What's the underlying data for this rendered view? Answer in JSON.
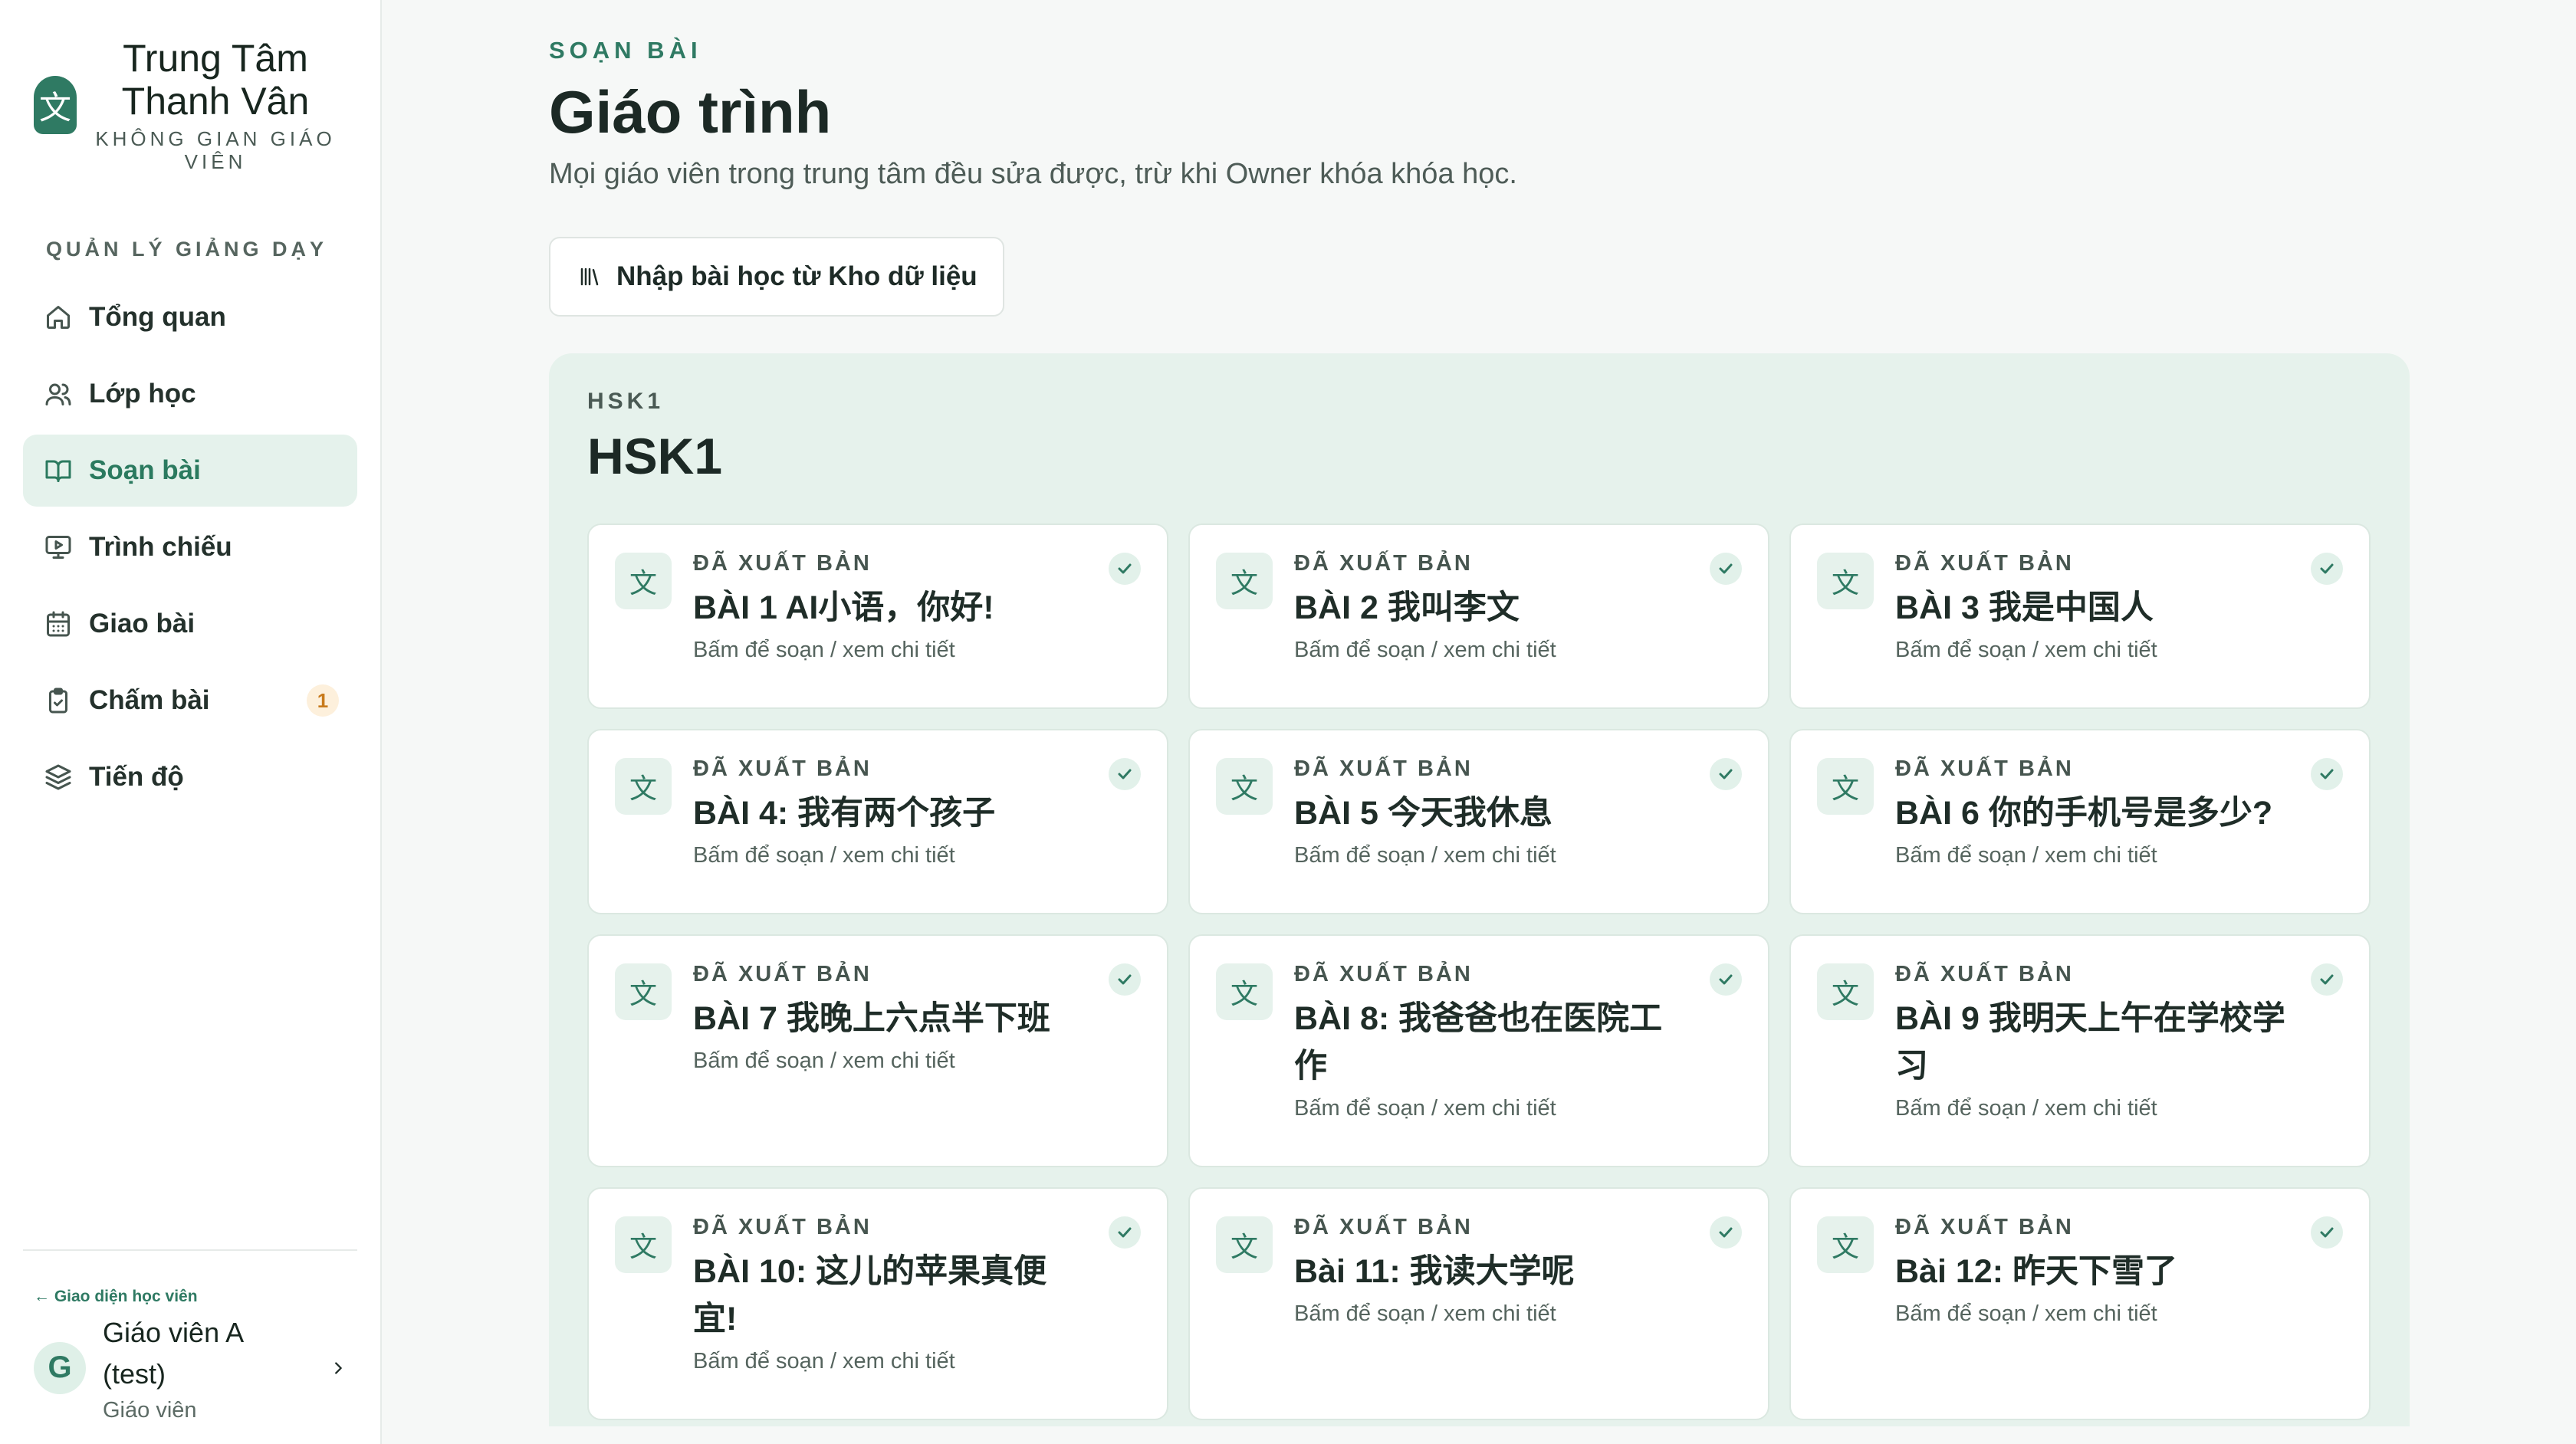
{
  "brand": {
    "icon_char": "文",
    "name_line1": "Trung Tâm",
    "name_line2": "Thanh Vân",
    "subtitle_line1": "KHÔNG GIAN GIÁO",
    "subtitle_line2": "VIÊN"
  },
  "sidebar": {
    "section_title": "QUẢN LÝ GIẢNG DẠY",
    "items": [
      {
        "label": "Tổng quan",
        "icon": "home-icon"
      },
      {
        "label": "Lớp học",
        "icon": "users-icon"
      },
      {
        "label": "Soạn bài",
        "icon": "book-open-icon",
        "active": true
      },
      {
        "label": "Trình chiếu",
        "icon": "presentation-icon"
      },
      {
        "label": "Giao bài",
        "icon": "calendar-icon"
      },
      {
        "label": "Chấm bài",
        "icon": "clipboard-check-icon",
        "badge": "1"
      },
      {
        "label": "Tiến độ",
        "icon": "layers-icon"
      }
    ]
  },
  "footer": {
    "student_link": "← Giao diện học viên",
    "avatar_initial": "G",
    "user_name_line1": "Giáo viên A",
    "user_name_line2": "(test)",
    "user_role": "Giáo viên"
  },
  "main": {
    "eyebrow": "SOẠN BÀI",
    "title": "Giáo trình",
    "description": "Mọi giáo viên trong trung tâm đều sửa được, trừ khi Owner khóa khóa học.",
    "import_button": "Nhập bài học từ Kho dữ liệu"
  },
  "course": {
    "tag": "HSK1",
    "title": "HSK1",
    "card_icon_char": "文",
    "lessons": [
      {
        "status": "ĐÃ XUẤT BẢN",
        "title_line1": "BÀI 1 AI小语，你好!",
        "title_line2": "",
        "hint": "Bấm để soạn / xem chi tiết"
      },
      {
        "status": "ĐÃ XUẤT BẢN",
        "title_line1": "BÀI 2 我叫李文",
        "title_line2": "",
        "hint": "Bấm để soạn / xem chi tiết"
      },
      {
        "status": "ĐÃ XUẤT BẢN",
        "title_line1": "BÀI 3 我是中国人",
        "title_line2": "",
        "hint": "Bấm để soạn / xem chi tiết"
      },
      {
        "status": "ĐÃ XUẤT BẢN",
        "title_line1": "BÀI 4: 我有两个孩子",
        "title_line2": "",
        "hint": "Bấm để soạn / xem chi tiết"
      },
      {
        "status": "ĐÃ XUẤT BẢN",
        "title_line1": "BÀI 5 今天我休息",
        "title_line2": "",
        "hint": "Bấm để soạn / xem chi tiết"
      },
      {
        "status": "ĐÃ XUẤT BẢN",
        "title_line1": "BÀI 6 你的手机号是多少?",
        "title_line2": "",
        "hint": "Bấm để soạn / xem chi tiết"
      },
      {
        "status": "ĐÃ XUẤT BẢN",
        "title_line1": "BÀI 7 我晚上六点半下班",
        "title_line2": "",
        "hint": "Bấm để soạn / xem chi tiết"
      },
      {
        "status": "ĐÃ XUẤT BẢN",
        "title_line1": "BÀI 8: 我爸爸也在医院工作",
        "title_line2": "",
        "hint": "Bấm để soạn / xem chi tiết"
      },
      {
        "status": "ĐÃ XUẤT BẢN",
        "title_line1": "BÀI 9 我明天上午在学校学",
        "title_line2": "习",
        "hint": "Bấm để soạn / xem chi tiết"
      },
      {
        "status": "ĐÃ XUẤT BẢN",
        "title_line1": "BÀI 10: 这儿的苹果真便",
        "title_line2": "宜!",
        "hint": "Bấm để soạn / xem chi tiết"
      },
      {
        "status": "ĐÃ XUẤT BẢN",
        "title_line1": "Bài 11: 我读大学呢",
        "title_line2": "",
        "hint": "Bấm để soạn / xem chi tiết"
      },
      {
        "status": "ĐÃ XUẤT BẢN",
        "title_line1": "Bài 12: 昨天下雪了",
        "title_line2": "",
        "hint": "Bấm để soạn / xem chi tiết"
      }
    ]
  },
  "colors": {
    "accent": "#2f7a63",
    "active_bg": "#e5f2ec",
    "panel_bg": "#e6f2ec",
    "badge_bg": "#fdf0dc",
    "badge_text": "#c87a1c"
  }
}
